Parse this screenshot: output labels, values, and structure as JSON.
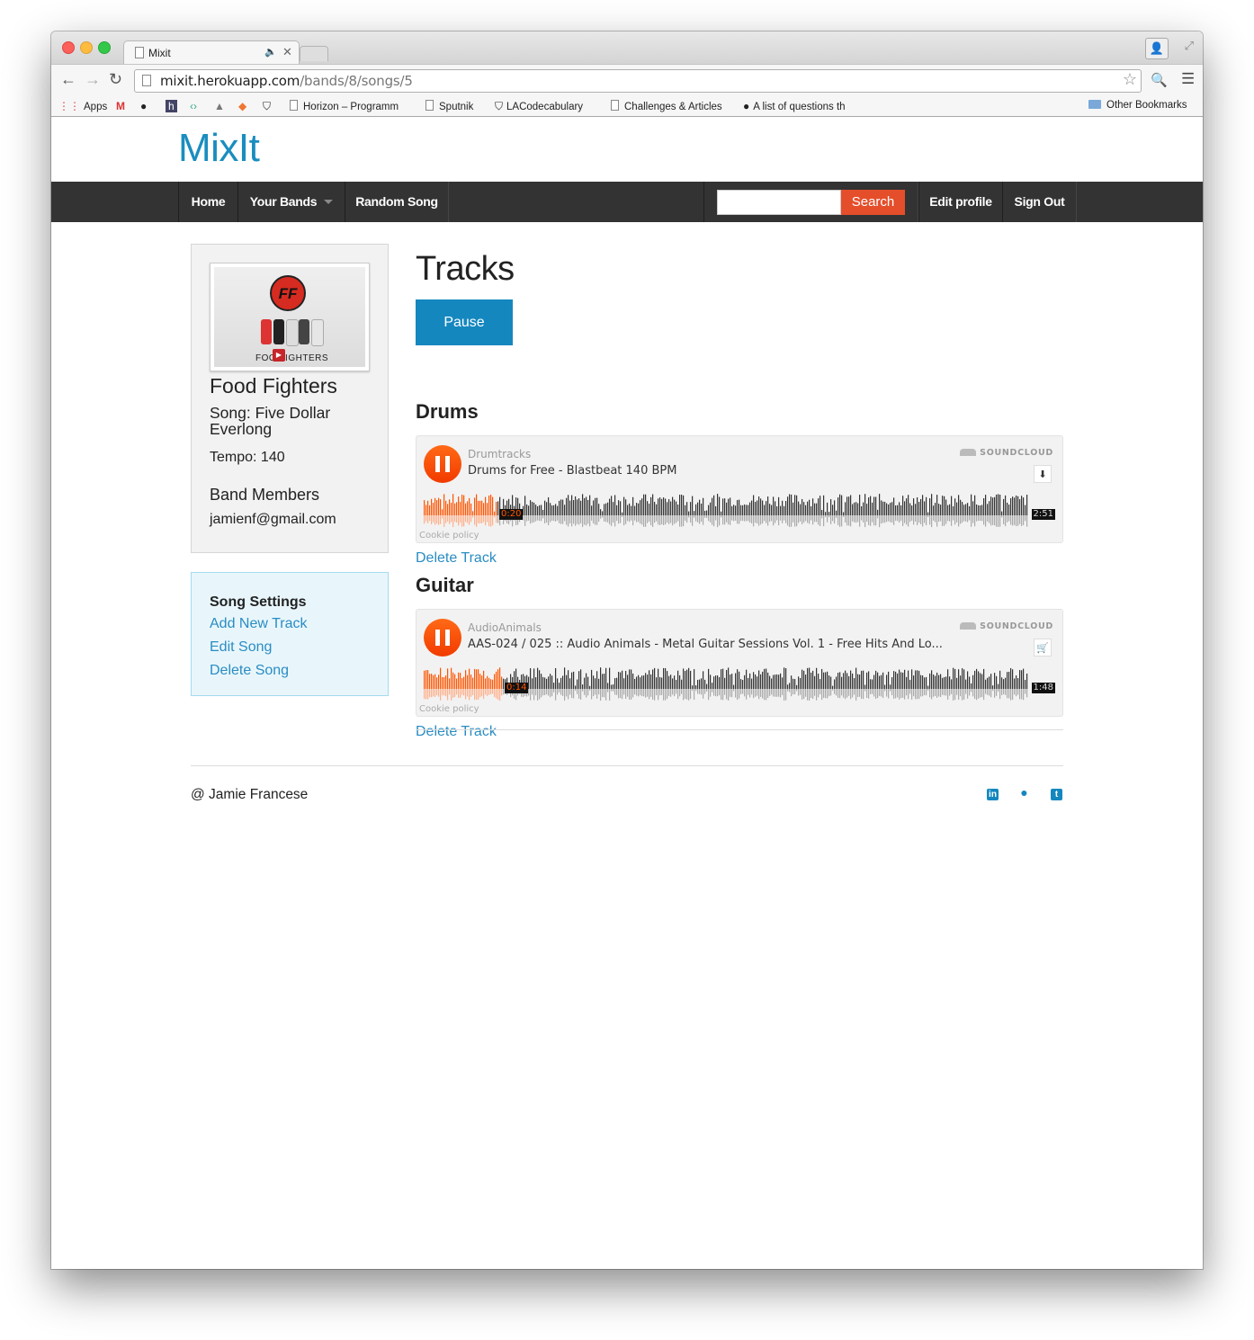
{
  "browser": {
    "tab_title": "Mixit",
    "url_host": "mixit.herokuapp.com",
    "url_path": "/bands/8/songs/5",
    "bookmarks": {
      "apps": "Apps",
      "horizon": "Horizon – Programm",
      "sputnik": "Sputnik",
      "lacode": "LACodecabulary",
      "challenges": "Challenges & Articles",
      "questions": "A list of questions th",
      "other": "Other Bookmarks"
    }
  },
  "header": {
    "brand": "MixIt",
    "nav": {
      "home": "Home",
      "your_bands": "Your Bands",
      "random_song": "Random Song",
      "search_button": "Search",
      "search_value": "",
      "edit_profile": "Edit profile",
      "sign_out": "Sign Out"
    }
  },
  "sidebar": {
    "band_image_text": "FOO FIGHTERS",
    "band_name": "Food Fighters",
    "song": "Song: Five Dollar Everlong",
    "tempo": "Tempo: 140",
    "members_heading": "Band Members",
    "members": [
      "jamienf@gmail.com"
    ],
    "settings": {
      "heading": "Song Settings",
      "add_track": "Add New Track",
      "edit_song": "Edit Song",
      "delete_song": "Delete Song"
    }
  },
  "main": {
    "heading": "Tracks",
    "pause_button": "Pause",
    "tracks": [
      {
        "label": "Drums",
        "artist": "Drumtracks",
        "title": "Drums for Free - Blastbeat 140 BPM",
        "current_time": "0:20",
        "duration": "2:51",
        "progress": 0.12,
        "action_icon": "download-icon",
        "delete": "Delete Track"
      },
      {
        "label": "Guitar",
        "artist": "AudioAnimals",
        "title": "AAS-024 / 025 :: Audio Animals - Metal Guitar Sessions Vol. 1 - Free Hits And Lo...",
        "current_time": "0:14",
        "duration": "1:48",
        "progress": 0.13,
        "action_icon": "cart-icon",
        "delete": "Delete Track"
      }
    ],
    "soundcloud_label": "SOUNDCLOUD",
    "cookie_policy": "Cookie policy"
  },
  "footer": {
    "copyright": "@ Jamie Francese",
    "social_icons": [
      "linkedin-icon",
      "github-icon",
      "twitter-icon"
    ]
  },
  "colors": {
    "brand": "#1a8dbf",
    "navbar": "#333333",
    "search_button": "#e44e2b",
    "pause_button": "#1587bf",
    "link": "#2a8cc2",
    "waveform_played": "#ff5500",
    "waveform_unplayed": "#333333"
  }
}
